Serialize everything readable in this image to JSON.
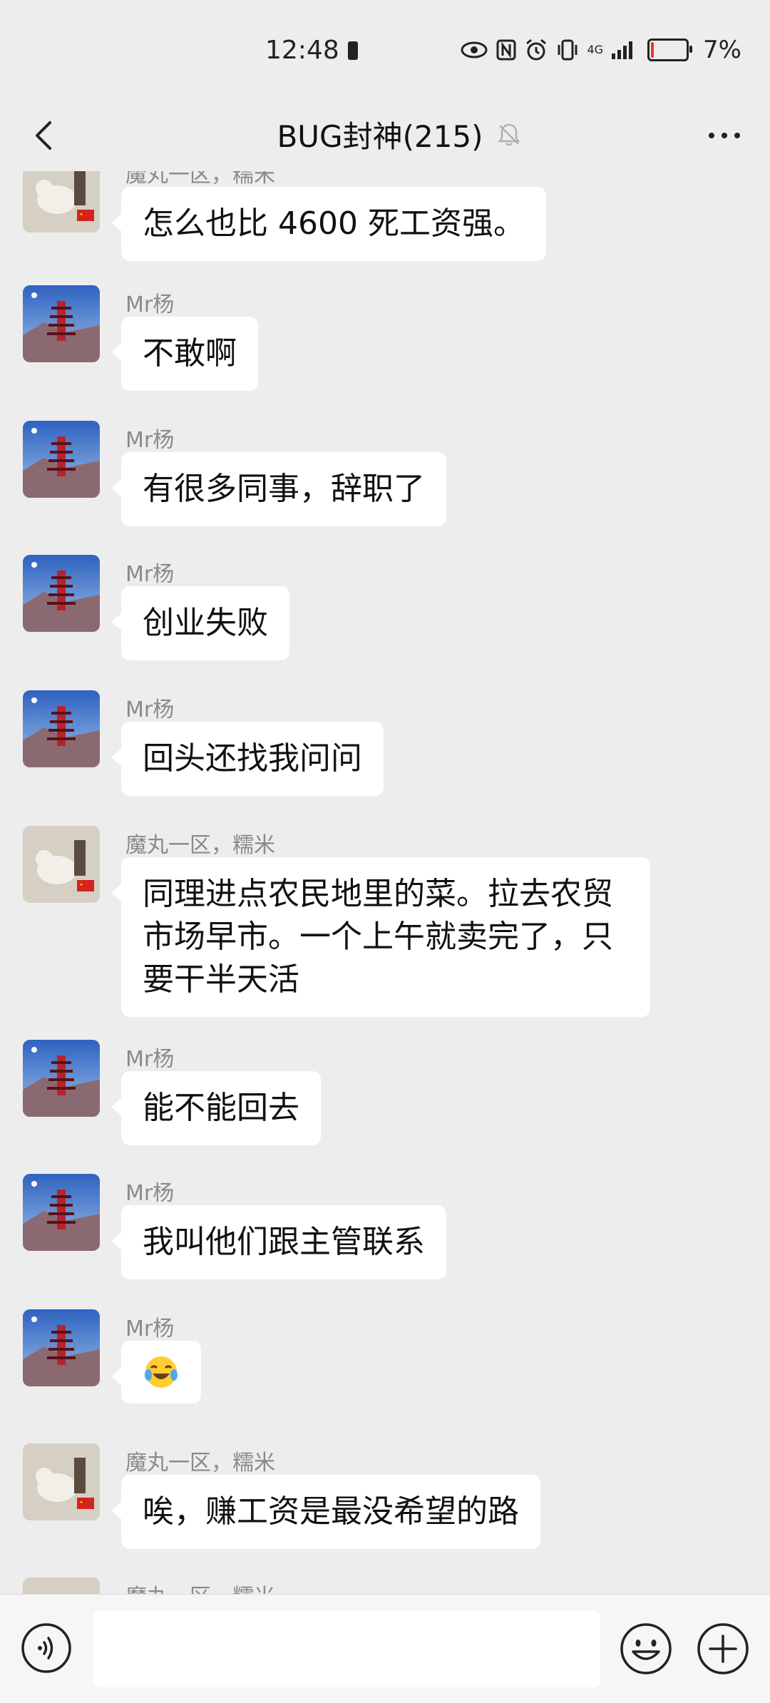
{
  "status_bar": {
    "time": "12:48",
    "battery": "7%",
    "network": "4G"
  },
  "header": {
    "title": "BUG封神(215)"
  },
  "messages": [
    {
      "type": "cut",
      "sender": "魔丸一区，糯米",
      "text": "怎么也比 4600 死工资强。",
      "avatar": "dog"
    },
    {
      "type": "text",
      "sender": "Mr杨",
      "text": "不敢啊",
      "avatar": "pagoda"
    },
    {
      "type": "text",
      "sender": "Mr杨",
      "text": "有很多同事，辞职了",
      "avatar": "pagoda"
    },
    {
      "type": "text",
      "sender": "Mr杨",
      "text": "创业失败",
      "avatar": "pagoda"
    },
    {
      "type": "text",
      "sender": "Mr杨",
      "text": "回头还找我问问",
      "avatar": "pagoda"
    },
    {
      "type": "text",
      "sender": "魔丸一区，糯米",
      "text": [
        "同理进点农民地里的菜。拉去农贸",
        "市场早市。一个上午就卖完了，只",
        "要干半天活"
      ],
      "avatar": "dog"
    },
    {
      "type": "text",
      "sender": "Mr杨",
      "text": "能不能回去",
      "avatar": "pagoda"
    },
    {
      "type": "text",
      "sender": "Mr杨",
      "text": "我叫他们跟主管联系",
      "avatar": "pagoda"
    },
    {
      "type": "emoji",
      "sender": "Mr杨",
      "emoji": "laughing-crying-emoji",
      "avatar": "pagoda"
    },
    {
      "type": "text",
      "sender": "魔丸一区，糯米",
      "text": "唉，赚工资是最没希望的路",
      "avatar": "dog"
    },
    {
      "type": "cut",
      "sender": "魔丸一区，糯米",
      "avatar": "dog"
    }
  ],
  "input": {
    "value": "",
    "placeholder": ""
  }
}
